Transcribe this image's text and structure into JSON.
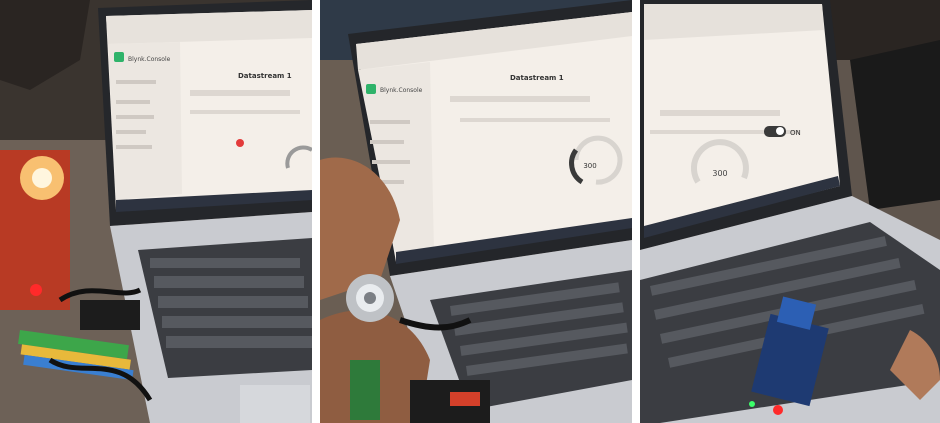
{
  "panels": [
    {
      "id": "photo-1",
      "screen": {
        "logo_text": "Blynk.Console",
        "device_title": "Datastream 1",
        "gauge_value": ""
      }
    },
    {
      "id": "photo-2",
      "screen": {
        "logo_text": "Blynk.Console",
        "device_title": "Datastream 1",
        "gauge_value": "300"
      }
    },
    {
      "id": "photo-3",
      "screen": {
        "logo_text": "",
        "device_title": "",
        "gauge_value": "300",
        "toggle_label": "ON"
      }
    }
  ],
  "colors": {
    "background": "#ffffff",
    "screen_bg": "#f4efe9",
    "blynk_green": "#2fb36a",
    "led_red": "#ff2a2a",
    "laptop_body": "#c9cbd0",
    "keyboard": "#3b3d42"
  }
}
